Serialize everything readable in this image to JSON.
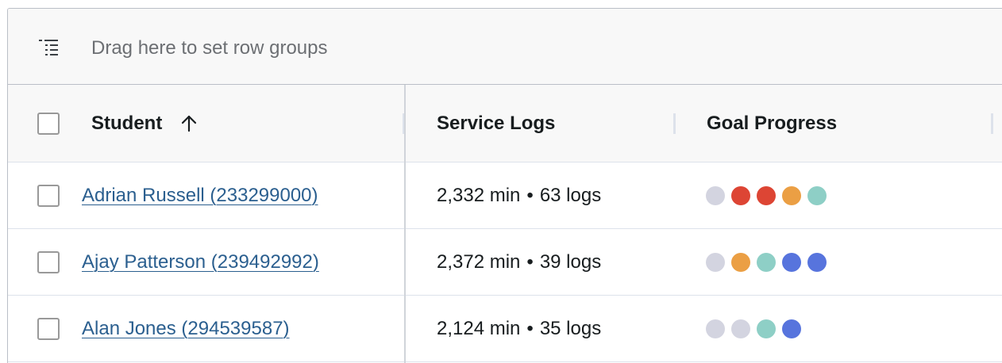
{
  "group_panel": {
    "placeholder": "Drag here to set row groups",
    "icon": "row-group-icon"
  },
  "columns": [
    {
      "key": "student",
      "label": "Student",
      "sort": "ascending",
      "sort_icon": "arrow-up-icon"
    },
    {
      "key": "service_logs",
      "label": "Service Logs"
    },
    {
      "key": "goal_progress",
      "label": "Goal Progress"
    }
  ],
  "colors": {
    "gray": "#d3d4e0",
    "red": "#dd4534",
    "orange": "#eb9f44",
    "teal": "#8ecfc6",
    "blue": "#5774dd",
    "link": "#2b5f8f"
  },
  "rows": [
    {
      "student": "Adrian Russell (233299000)",
      "minutes": "2,332 min",
      "separator": "•",
      "logs": "63 logs",
      "goals": [
        "gray",
        "red",
        "red",
        "orange",
        "teal"
      ]
    },
    {
      "student": "Ajay Patterson (239492992)",
      "minutes": "2,372 min",
      "separator": "•",
      "logs": "39 logs",
      "goals": [
        "gray",
        "orange",
        "teal",
        "blue",
        "blue"
      ]
    },
    {
      "student": "Alan Jones (294539587)",
      "minutes": "2,124 min",
      "separator": "•",
      "logs": "35 logs",
      "goals": [
        "gray",
        "gray",
        "teal",
        "blue"
      ]
    }
  ]
}
